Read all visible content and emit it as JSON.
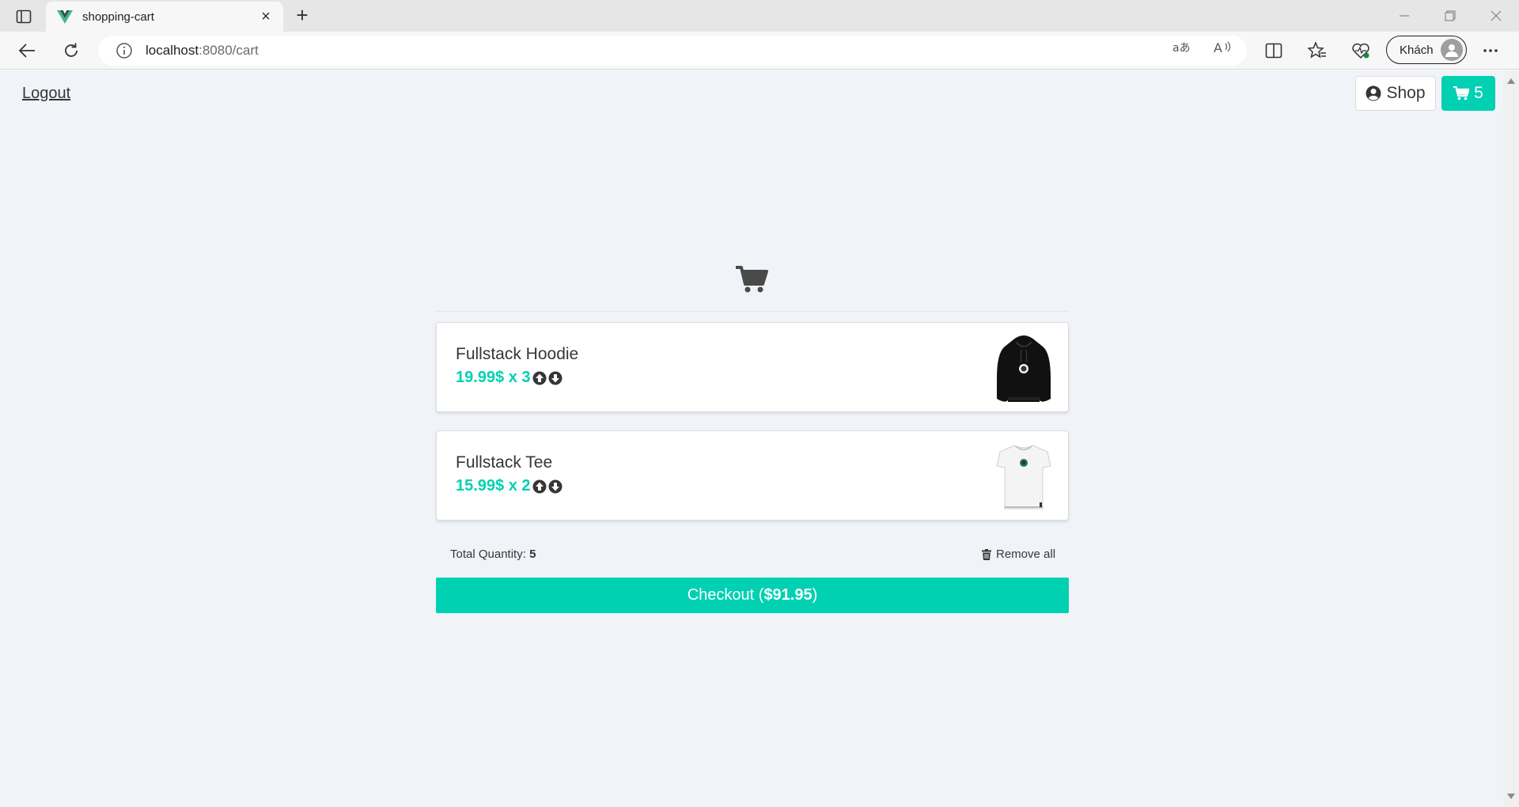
{
  "browser": {
    "tab_title": "shopping-cart",
    "url_host": "localhost",
    "url_rest": ":8080/cart",
    "profile_label": "Khách"
  },
  "nav": {
    "logout_label": "Logout",
    "shop_label": "Shop",
    "cart_count": "5"
  },
  "cart": {
    "items": [
      {
        "name": "Fullstack Hoodie",
        "price": "19.99$",
        "qty_text": "x 3",
        "image": "black-hoodie"
      },
      {
        "name": "Fullstack Tee",
        "price": "15.99$",
        "qty_text": "x 2",
        "image": "white-tee"
      }
    ],
    "total_quantity_label": "Total Quantity:",
    "total_quantity_value": "5",
    "remove_all_label": "Remove all",
    "checkout_prefix": "Checkout (",
    "checkout_amount": "$91.95",
    "checkout_suffix": ")"
  },
  "colors": {
    "primary": "#00d1b2",
    "background": "#f0f4f8",
    "text": "#363636"
  }
}
